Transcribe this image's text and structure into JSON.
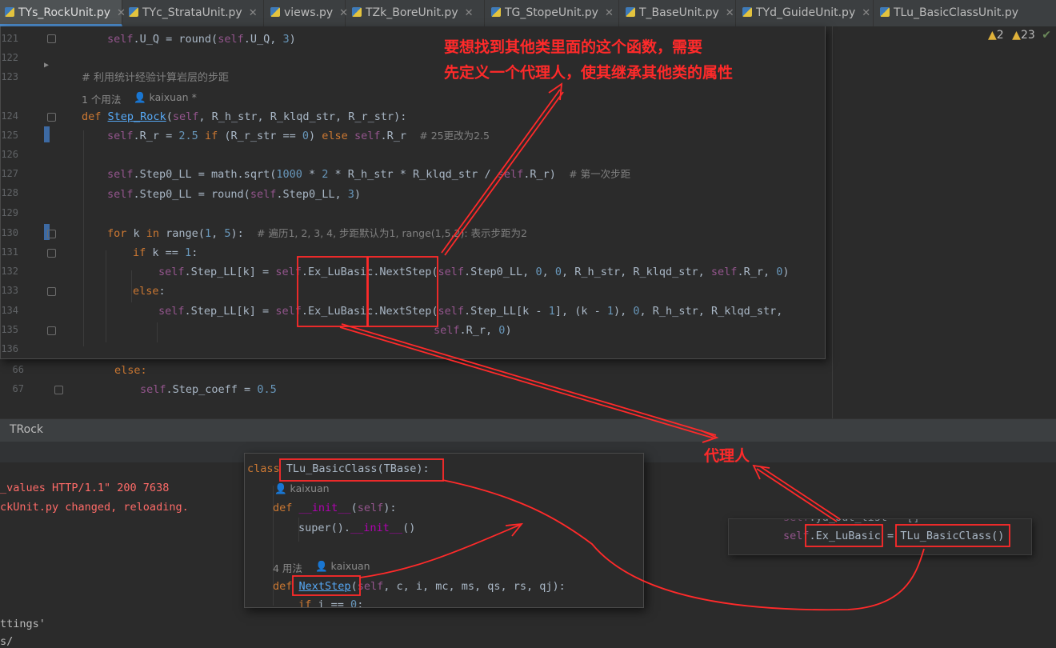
{
  "tabs": [
    {
      "label": "TYs_RockUnit.py",
      "active": true
    },
    {
      "label": "TYc_StrataUnit.py",
      "active": false
    },
    {
      "label": "views.py",
      "active": false
    },
    {
      "label": "TZk_BoreUnit.py",
      "active": false
    },
    {
      "label": "TG_StopeUnit.py",
      "active": false
    },
    {
      "label": "T_BaseUnit.py",
      "active": false
    },
    {
      "label": "TYd_GuideUnit.py",
      "active": false
    },
    {
      "label": "TLu_BasicClassUnit.py",
      "active": false
    }
  ],
  "inspections": {
    "warnings_a": "2",
    "warnings_b": "23"
  },
  "editor": {
    "line_numbers": [
      "121",
      "122",
      "123",
      "",
      "124",
      "125",
      "126",
      "127",
      "128",
      "129",
      "130",
      "131",
      "132",
      "133",
      "134",
      "135",
      "136"
    ],
    "usage_hint": "1 个用法",
    "author_hint": "kaixuan *",
    "comment_rock": "# 利用统计经验计算岩层的步距",
    "comment_25": "# 25更改为2.5",
    "comment_first": "# 第一次步距",
    "comment_loop": "# 遍历1, 2, 3, 4, 步距默认为1, range(1,5,2): 表示步距为2"
  },
  "background_code": {
    "line_numbers": [
      "66",
      "67"
    ],
    "else_text": "else:",
    "coeff_self": "self",
    "coeff_rest": ".Step_coeff = ",
    "coeff_val": "0.5"
  },
  "tool_window": {
    "title": "TRock",
    "console_lines": [
      "_values HTTP/1.1\" 200 7638",
      "ckUnit.py changed, reloading.",
      "ttings'",
      "s/"
    ]
  },
  "class_popup": {
    "author1": "kaixuan",
    "usage2": "4 用法",
    "author2": "kaixuan"
  },
  "proxy_popup": {
    "attr": ".Ex_LuBasic",
    "eq": " = ",
    "ctor": "TLu_BasicClass()"
  },
  "annotations": {
    "note_line1": "要想找到其他类里面的这个函数，需要",
    "note_line2": "先定义一个代理人，使其继承其他类的属性",
    "proxy_label": "代理人",
    "color": "#ff2a2a"
  }
}
